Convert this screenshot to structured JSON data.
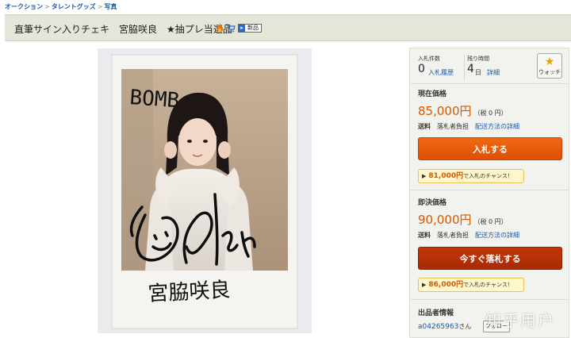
{
  "breadcrumb": [
    "オークション",
    "タレントグッズ",
    "写真"
  ],
  "listing": {
    "title": "直筆サイン入りチェキ　宮脇咲良　★抽プレ当選品",
    "badge_new": "新品"
  },
  "photo": {
    "signature_texts": [
      "BOMB",
      "Sakura",
      "宮脇咲良"
    ]
  },
  "stats": {
    "bids_label": "入札件数",
    "bids_value": "0",
    "bid_history_link": "入札履歴",
    "remaining_label": "残り時間",
    "remaining_value": "4",
    "remaining_unit": "日",
    "details_link": "詳細",
    "watch_label": "ウォッチ"
  },
  "current": {
    "title": "現在価格",
    "price": "85,000円",
    "tax": "（税 0 円）",
    "shipping_label": "送料",
    "shipping_value": "落札者負担",
    "shipping_link": "配送方法の詳細",
    "bid_button": "入札する",
    "chance_amount": "81,000円",
    "chance_text": "で入札のチャンス！"
  },
  "buynow": {
    "title": "即決価格",
    "price": "90,000円",
    "tax": "（税 0 円）",
    "shipping_label": "送料",
    "shipping_value": "落札者負担",
    "shipping_link": "配送方法の詳細",
    "buy_button": "今すぐ落札する",
    "chance_amount": "86,000円",
    "chance_text": "で入札のチャンス！"
  },
  "seller": {
    "title": "出品者情報",
    "name": "a04265963",
    "suffix": "さん",
    "follow_button": "フォロー"
  },
  "watermark": "知乎用户",
  "colors": {
    "link": "#1b5aa8",
    "price": "#d25a00",
    "bid_button": "#e35606",
    "buy_button": "#b4300a",
    "chance_bg": "#fff6cc"
  }
}
